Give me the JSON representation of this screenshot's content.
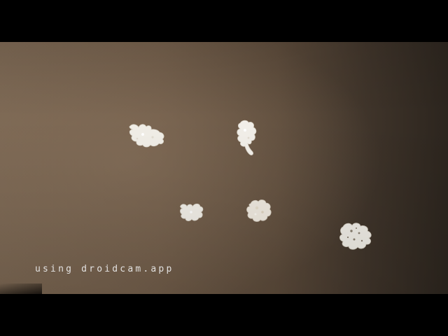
{
  "scene": {
    "description_colors": {
      "wall_light": "#7a6652",
      "wall_dark": "#2c251e",
      "spot_color": "#f2efe8",
      "letterbox": "#000000"
    }
  },
  "overlay": {
    "watermark_text": "using droidcam.app"
  }
}
